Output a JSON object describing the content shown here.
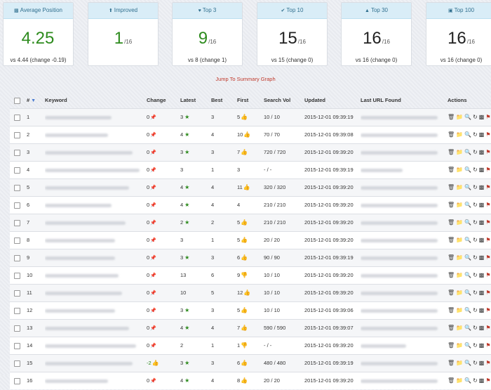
{
  "cards": [
    {
      "title": "Average Position",
      "icon": "bar-chart-icon",
      "value": "4.25",
      "denominator": "",
      "foot": "vs 4.44 (change -0.19)",
      "green": true
    },
    {
      "title": "Improved",
      "icon": "arrow-up-icon",
      "value": "1",
      "denominator": "/16",
      "foot": "",
      "green": true
    },
    {
      "title": "Top 3",
      "icon": "heart-icon",
      "value": "9",
      "denominator": "/16",
      "foot": "vs 8 (change 1)",
      "green": true
    },
    {
      "title": "Top 10",
      "icon": "check-icon",
      "value": "15",
      "denominator": "/16",
      "foot": "vs 15 (change 0)",
      "green": false
    },
    {
      "title": "Top 30",
      "icon": "road-icon",
      "value": "16",
      "denominator": "/16",
      "foot": "vs 16 (change 0)",
      "green": false
    },
    {
      "title": "Top 100",
      "icon": "briefcase-icon",
      "value": "16",
      "denominator": "/16",
      "foot": "vs 16 (change 0)",
      "green": false
    }
  ],
  "jump_link": "Jump To Summary Graph",
  "headers": {
    "num": "#",
    "keyword": "Keyword",
    "change": "Change",
    "latest": "Latest",
    "best": "Best",
    "first": "First",
    "vol": "Search Vol",
    "updated": "Updated",
    "url": "Last URL Found",
    "actions": "Actions"
  },
  "rows": [
    {
      "num": "1",
      "change": "0",
      "latest": "3",
      "latest_star": true,
      "best": "3",
      "first": "5",
      "first_icon": "up",
      "vol": "10 / 10",
      "updated": "2015-12-01 09:39:19",
      "kw_w": 95,
      "url_w": 110
    },
    {
      "num": "2",
      "change": "0",
      "latest": "4",
      "latest_star": true,
      "best": "4",
      "first": "10",
      "first_icon": "up",
      "vol": "70 / 70",
      "updated": "2015-12-01 09:39:08",
      "kw_w": 90,
      "url_w": 110
    },
    {
      "num": "3",
      "change": "0",
      "latest": "3",
      "latest_star": true,
      "best": "3",
      "first": "7",
      "first_icon": "up",
      "vol": "720 / 720",
      "updated": "2015-12-01 09:39:20",
      "kw_w": 125,
      "url_w": 110
    },
    {
      "num": "4",
      "change": "0",
      "latest": "3",
      "latest_star": false,
      "best": "1",
      "first": "3",
      "first_icon": "",
      "vol": "- / -",
      "updated": "2015-12-01 09:39:19",
      "kw_w": 135,
      "url_w": 60
    },
    {
      "num": "5",
      "change": "0",
      "latest": "4",
      "latest_star": true,
      "best": "4",
      "first": "11",
      "first_icon": "up",
      "vol": "320 / 320",
      "updated": "2015-12-01 09:39:20",
      "kw_w": 120,
      "url_w": 110
    },
    {
      "num": "6",
      "change": "0",
      "latest": "4",
      "latest_star": true,
      "best": "4",
      "first": "4",
      "first_icon": "",
      "vol": "210 / 210",
      "updated": "2015-12-01 09:39:20",
      "kw_w": 95,
      "url_w": 110
    },
    {
      "num": "7",
      "change": "0",
      "latest": "2",
      "latest_star": true,
      "best": "2",
      "first": "5",
      "first_icon": "up",
      "vol": "210 / 210",
      "updated": "2015-12-01 09:39:20",
      "kw_w": 115,
      "url_w": 110
    },
    {
      "num": "8",
      "change": "0",
      "latest": "3",
      "latest_star": false,
      "best": "1",
      "first": "5",
      "first_icon": "up",
      "vol": "20 / 20",
      "updated": "2015-12-01 09:39:20",
      "kw_w": 100,
      "url_w": 110
    },
    {
      "num": "9",
      "change": "0",
      "latest": "3",
      "latest_star": true,
      "best": "3",
      "first": "6",
      "first_icon": "up",
      "vol": "90 / 90",
      "updated": "2015-12-01 09:39:19",
      "kw_w": 100,
      "url_w": 110
    },
    {
      "num": "10",
      "change": "0",
      "latest": "13",
      "latest_star": false,
      "best": "6",
      "first": "9",
      "first_icon": "down",
      "vol": "10 / 10",
      "updated": "2015-12-01 09:39:20",
      "kw_w": 105,
      "url_w": 110
    },
    {
      "num": "11",
      "change": "0",
      "latest": "10",
      "latest_star": false,
      "best": "5",
      "first": "12",
      "first_icon": "up",
      "vol": "10 / 10",
      "updated": "2015-12-01 09:39:20",
      "kw_w": 110,
      "url_w": 110
    },
    {
      "num": "12",
      "change": "0",
      "latest": "3",
      "latest_star": true,
      "best": "3",
      "first": "5",
      "first_icon": "up",
      "vol": "10 / 10",
      "updated": "2015-12-01 09:39:06",
      "kw_w": 100,
      "url_w": 110
    },
    {
      "num": "13",
      "change": "0",
      "latest": "4",
      "latest_star": true,
      "best": "4",
      "first": "7",
      "first_icon": "up",
      "vol": "590 / 590",
      "updated": "2015-12-01 09:39:07",
      "kw_w": 120,
      "url_w": 110
    },
    {
      "num": "14",
      "change": "0",
      "latest": "2",
      "latest_star": false,
      "best": "1",
      "first": "1",
      "first_icon": "down",
      "vol": "- / -",
      "updated": "2015-12-01 09:39:20",
      "kw_w": 130,
      "url_w": 65
    },
    {
      "num": "15",
      "change": "-2",
      "latest": "3",
      "latest_star": true,
      "best": "3",
      "first": "6",
      "first_icon": "up",
      "vol": "480 / 480",
      "updated": "2015-12-01 09:39:19",
      "kw_w": 125,
      "url_w": 110
    },
    {
      "num": "16",
      "change": "0",
      "latest": "4",
      "latest_star": true,
      "best": "4",
      "first": "8",
      "first_icon": "up",
      "vol": "20 / 20",
      "updated": "2015-12-01 09:39:20",
      "kw_w": 90,
      "url_w": 110
    }
  ],
  "colors": {
    "header_bg": "#d9edf7",
    "header_text": "#31708f",
    "green": "#2e8b1e",
    "red": "#d23b2b"
  }
}
